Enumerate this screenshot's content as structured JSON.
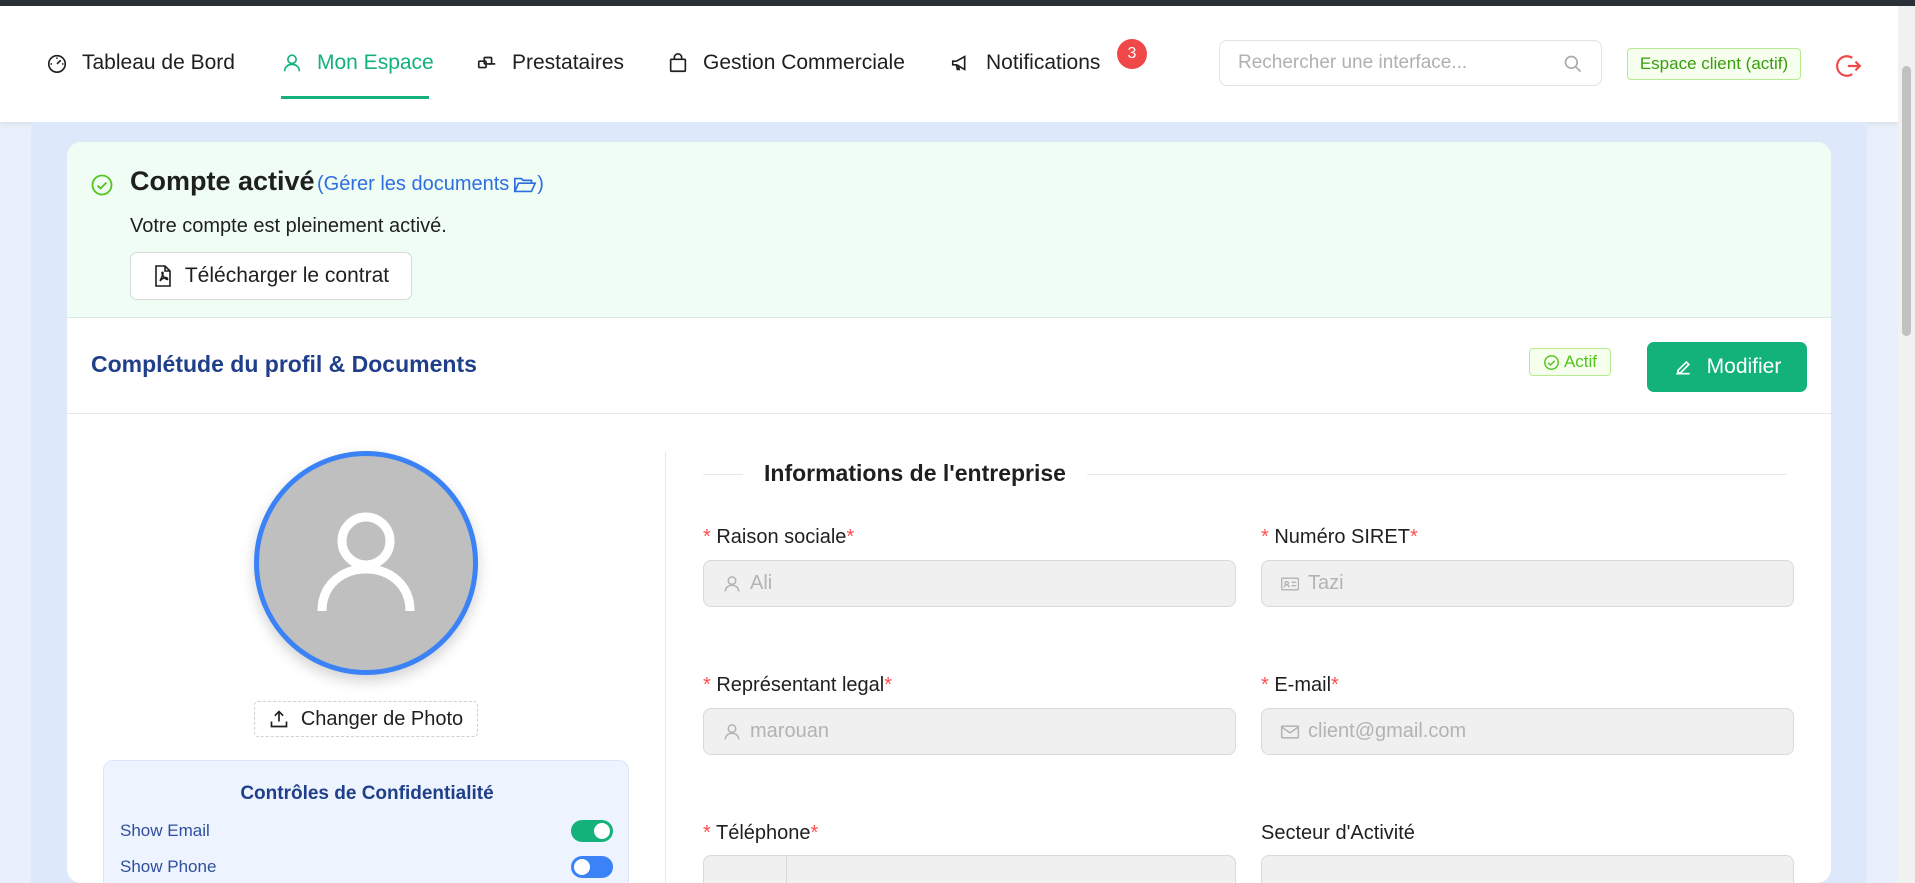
{
  "nav": {
    "items": [
      {
        "label": "Tableau de Bord",
        "icon": "dashboard-icon"
      },
      {
        "label": "Mon Espace",
        "icon": "user-icon"
      },
      {
        "label": "Prestataires",
        "icon": "prestataires-icon"
      },
      {
        "label": "Gestion Commerciale",
        "icon": "shopping-bag-icon"
      },
      {
        "label": "Notifications",
        "icon": "megaphone-icon"
      }
    ],
    "active": "Mon Espace",
    "notification_count": "3",
    "search_placeholder": "Rechercher une interface...",
    "client_tag": "Espace client (actif)"
  },
  "alert": {
    "title": "Compte activé",
    "link": "(Gérer les documents",
    "link_close": ")",
    "description": "Votre compte est pleinement activé.",
    "download_button": "Télécharger le contrat"
  },
  "profile": {
    "section_title": "Complétude du profil & Documents",
    "status_tag": "Actif",
    "edit_button": "Modifier",
    "change_photo": "Changer de Photo"
  },
  "privacy": {
    "title": "Contrôles de Confidentialité",
    "rows": [
      {
        "label": "Show Email",
        "enabled": true,
        "color": "#12b27a"
      },
      {
        "label": "Show Phone",
        "enabled": false,
        "color": "#3b82f6"
      }
    ]
  },
  "company": {
    "title": "Informations de l'entreprise",
    "fields": [
      {
        "label": "Raison sociale",
        "value": "Ali",
        "required": true,
        "icon": "user-icon"
      },
      {
        "label": "Numéro SIRET",
        "value": "Tazi",
        "required": true,
        "icon": "id-card-icon"
      },
      {
        "label": "Représentant legal",
        "value": "marouan",
        "required": true,
        "icon": "user-icon"
      },
      {
        "label": "E-mail",
        "value": "client@gmail.com",
        "required": true,
        "icon": "mail-icon"
      },
      {
        "label": "Téléphone",
        "value": "",
        "required": true
      },
      {
        "label": "Secteur d'Activité",
        "value": "",
        "required": false
      }
    ]
  },
  "colors": {
    "accent": "#12b27a",
    "link": "#2e6fe0",
    "title_blue": "#1f3f8a",
    "required": "#ff4d4f"
  }
}
